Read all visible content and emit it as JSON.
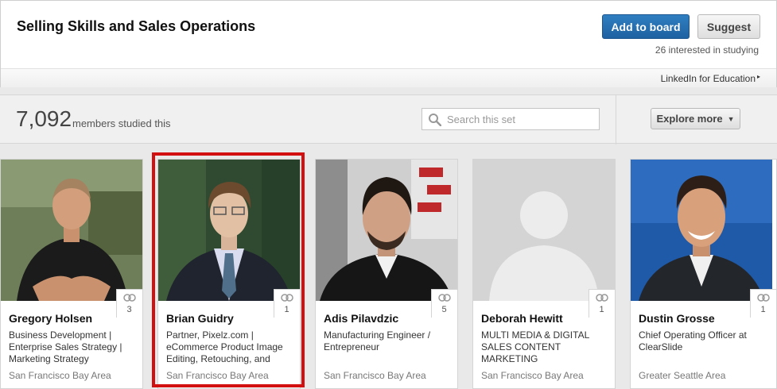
{
  "header": {
    "title": "Selling Skills and Sales Operations",
    "add_label": "Add to board",
    "suggest_label": "Suggest",
    "interested_text": "26 interested in studying",
    "edu_link": "LinkedIn for Education"
  },
  "stats": {
    "count": "7,092",
    "count_label": "members studied this",
    "search_placeholder": "Search this set",
    "explore_label": "Explore more"
  },
  "members": [
    {
      "name": "Gregory Holsen",
      "headline": "Business Development | Enterprise Sales Strategy | Marketing Strategy",
      "location": "San Francisco Bay Area",
      "count": "3"
    },
    {
      "name": "Brian Guidry",
      "headline": "Partner, Pixelz.com | eCommerce Product Image Editing, Retouching, and",
      "location": "San Francisco Bay Area",
      "count": "1"
    },
    {
      "name": "Adis Pilavdzic",
      "headline": "Manufacturing Engineer / Entrepreneur",
      "location": "San Francisco Bay Area",
      "count": "5"
    },
    {
      "name": "Deborah Hewitt",
      "headline": "MULTI MEDIA & DIGITAL SALES CONTENT MARKETING",
      "location": "San Francisco Bay Area",
      "count": "1"
    },
    {
      "name": "Dustin Grosse",
      "headline": "Chief Operating Officer at ClearSlide",
      "location": "Greater Seattle Area",
      "count": "1"
    }
  ],
  "colors": {
    "primary_button": "#2370b5",
    "highlight_border": "#d21010"
  }
}
